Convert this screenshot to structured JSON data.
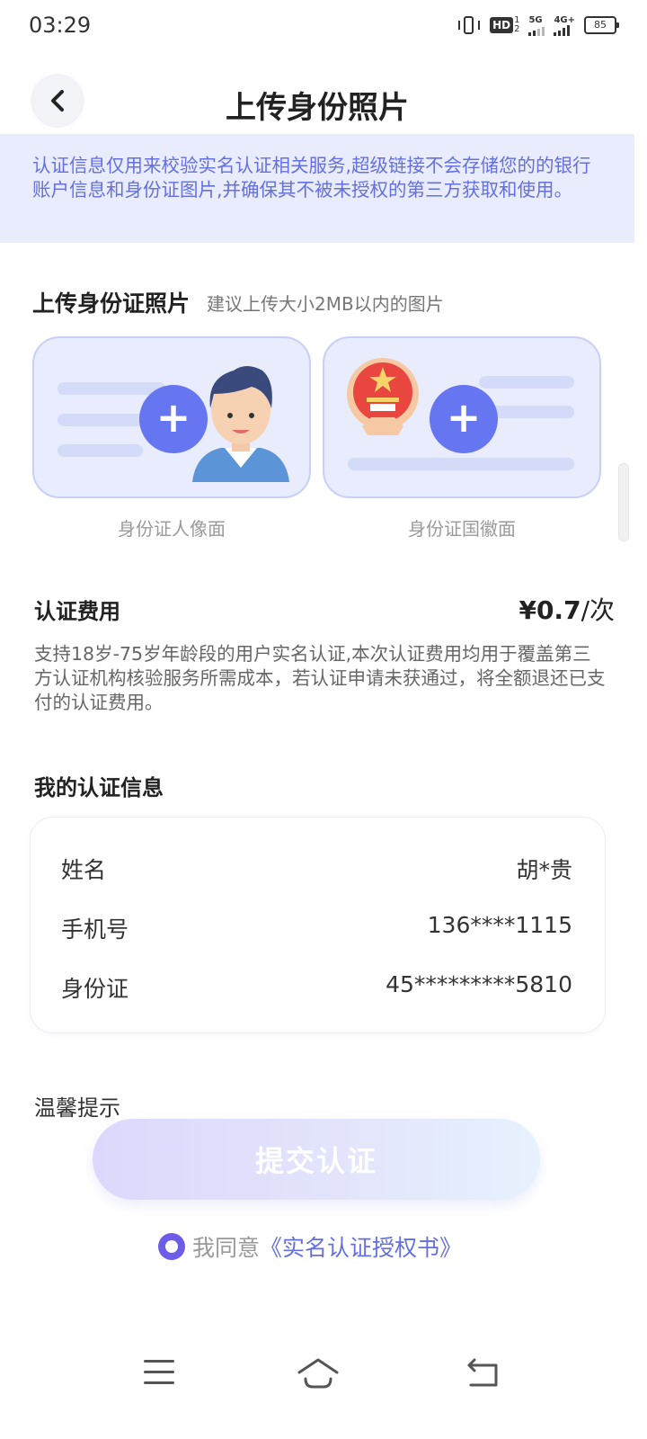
{
  "status_bar": {
    "time": "03:29",
    "hd_label": "HD",
    "hd_sup": "1",
    "hd_sub": "2",
    "net1": "5G",
    "net2": "4G+",
    "battery": "85"
  },
  "header": {
    "title": "上传身份照片",
    "back_icon": "chevron-left-icon"
  },
  "notice": {
    "text": "认证信息仅用来校验实名认证相关服务,超级链接不会存储您的的银行账户信息和身份证图片,并确保其不被未授权的第三方获取和使用。"
  },
  "upload": {
    "title": "上传身份证照片",
    "hint": "建议上传大小2MB以内的图片",
    "cards": [
      {
        "label": "身份证人像面",
        "plus": "+",
        "icon": "person-avatar-icon"
      },
      {
        "label": "身份证国徽面",
        "plus": "+",
        "icon": "national-emblem-icon"
      }
    ]
  },
  "fee": {
    "title": "认证费用",
    "price": "¥0.7",
    "unit": "/次",
    "description": "支持18岁-75岁年龄段的用户实名认证,本次认证费用均用于覆盖第三方认证机构核验服务所需成本，若认证申请未获通过，将全额退还已支付的认证费用。"
  },
  "my_info": {
    "title": "我的认证信息",
    "rows": [
      {
        "label": "姓名",
        "value": "胡*贵"
      },
      {
        "label": "手机号",
        "value": "136****1115"
      },
      {
        "label": "身份证",
        "value": "45*********5810"
      }
    ]
  },
  "tips": {
    "title": "温馨提示"
  },
  "submit": {
    "label": "提交认证"
  },
  "agreement": {
    "prefix": "我同意",
    "link": "《实名认证授权书》"
  },
  "colors": {
    "accent": "#6675f0",
    "notice_bg": "#e9ecfc",
    "notice_text": "#6470e0",
    "card_bg": "#e8ecfc"
  }
}
